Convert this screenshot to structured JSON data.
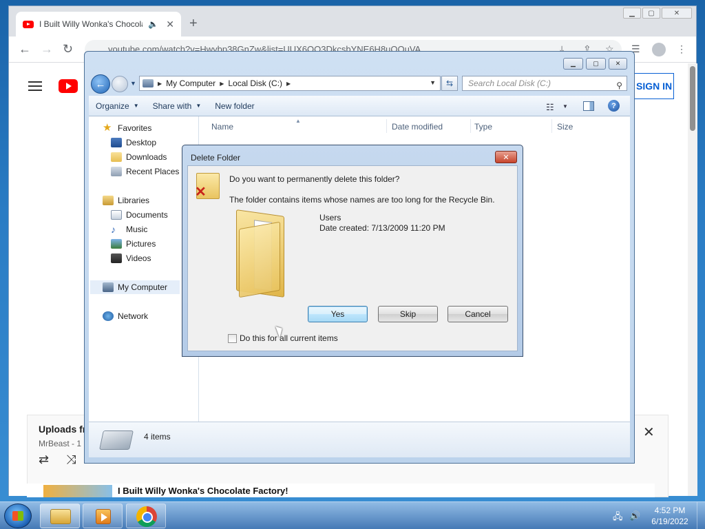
{
  "chrome": {
    "tab_title": "I Built Willy Wonka's Chocolate Factory!",
    "address": "youtube.com/watch?v=Hwybp38GnZw&list=UUX6OQ3DkcsbYNE6H8uQQuVA",
    "sign_in": "SIGN IN",
    "playlist_title": "Uploads from MrBeast",
    "playlist_channel": "MrBeast - 1",
    "playlist_video": "I Built Willy Wonka's Chocolate Factory!"
  },
  "explorer": {
    "breadcrumb": [
      "My Computer",
      "Local Disk (C:)"
    ],
    "search_placeholder": "Search Local Disk (C:)",
    "commands": [
      "Organize",
      "Share with",
      "New folder"
    ],
    "nav": {
      "favorites": "Favorites",
      "desktop": "Desktop",
      "downloads": "Downloads",
      "recent": "Recent Places",
      "libraries": "Libraries",
      "documents": "Documents",
      "music": "Music",
      "pictures": "Pictures",
      "videos": "Videos",
      "computer": "My Computer",
      "network": "Network"
    },
    "columns": [
      "Name",
      "Date modified",
      "Type",
      "Size"
    ],
    "status": "4 items"
  },
  "dialog": {
    "title": "Delete Folder",
    "question": "Do you want to permanently delete this folder?",
    "reason": "The folder contains items whose names are too long for the Recycle Bin.",
    "folder_name": "Users",
    "folder_date": "Date created: 7/13/2009 11:20 PM",
    "yes": "Yes",
    "skip": "Skip",
    "cancel": "Cancel",
    "checkbox_label": "Do this for all current items"
  },
  "taskbar": {
    "time": "4:52 PM",
    "date": "6/19/2022"
  }
}
